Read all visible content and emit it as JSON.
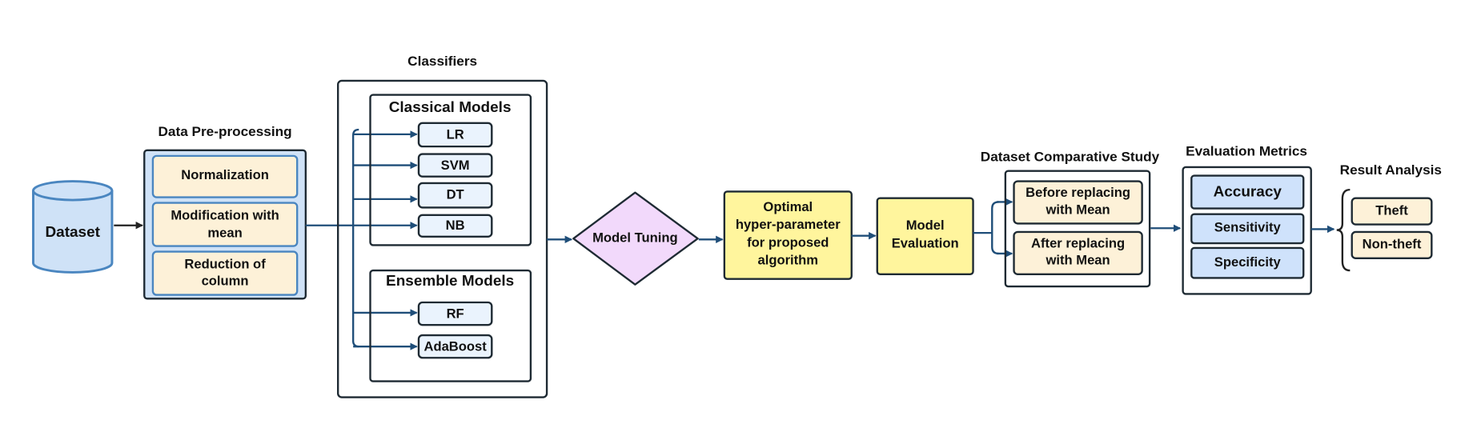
{
  "dataset": {
    "label": "Dataset"
  },
  "preprocessing": {
    "title": "Data Pre-processing",
    "steps": [
      {
        "line1": "Normalization",
        "line2": ""
      },
      {
        "line1": "Modification with",
        "line2": "mean"
      },
      {
        "line1": "Reduction of",
        "line2": "column"
      }
    ]
  },
  "classifiers": {
    "title": "Classifiers",
    "classical": {
      "title": "Classical Models",
      "items": [
        "LR",
        "SVM",
        "DT",
        "NB"
      ]
    },
    "ensemble": {
      "title": "Ensemble Models",
      "items": [
        "RF",
        "AdaBoost"
      ]
    }
  },
  "tuning": {
    "label": "Model Tuning"
  },
  "optimal": {
    "lines": [
      "Optimal",
      "hyper-parameter",
      "for proposed",
      "algorithm"
    ]
  },
  "evaluation": {
    "lines": [
      "Model",
      "Evaluation"
    ]
  },
  "comparative": {
    "title": "Dataset Comparative Study",
    "items": [
      {
        "line1": "Before replacing",
        "line2": "with Mean"
      },
      {
        "line1": "After replacing",
        "line2": "with Mean"
      }
    ]
  },
  "metrics": {
    "title": "Evaluation Metrics",
    "items": [
      "Accuracy",
      "Sensitivity",
      "Specificity"
    ]
  },
  "results": {
    "title": "Result Analysis",
    "items": [
      "Theft",
      "Non-theft"
    ]
  },
  "colors": {
    "arrow": "#1f4e79",
    "preprocess_bg": "#cfe2f7",
    "step_bg": "#fdf1d8",
    "model_bg": "#eaf3fd",
    "tuning_bg": "#f2d9fb",
    "yellow": "#fff59d",
    "metric_bg": "#cfe2fb"
  }
}
